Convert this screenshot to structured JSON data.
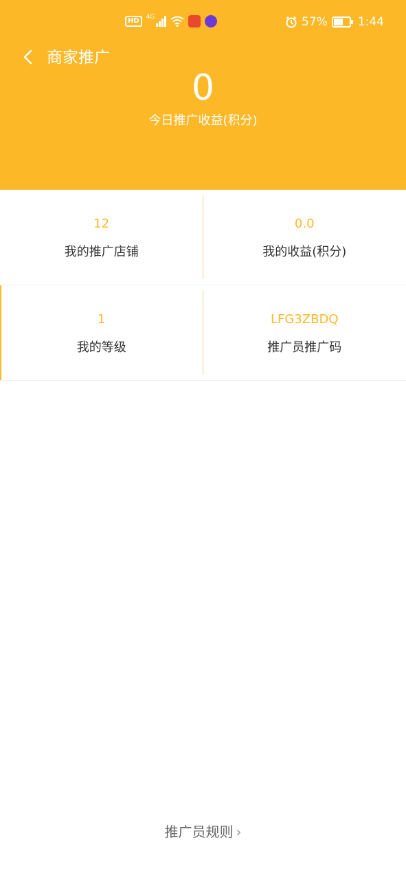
{
  "status_bar": {
    "hd": "HD",
    "network": "4G",
    "battery_percent": "57%",
    "time": "1:44",
    "battery_level": 0.57
  },
  "nav": {
    "title": "商家推广"
  },
  "summary": {
    "today_value": "0",
    "today_label": "今日推广收益(积分)"
  },
  "stats": [
    {
      "value": "12",
      "label": "我的推广店铺"
    },
    {
      "value": "0.0",
      "label": "我的收益(积分)"
    },
    {
      "value": "1",
      "label": "我的等级"
    },
    {
      "value": "LFG3ZBDQ",
      "label": "推广员推广码"
    }
  ],
  "footer": {
    "rules_label": "推广员规则",
    "chevron": "›"
  },
  "colors": {
    "accent": "#FDB827",
    "text_dark": "#333333",
    "text_muted": "#666666"
  },
  "icons": {
    "back": "chevron-left-icon",
    "alarm": "alarm-icon",
    "wifi": "wifi-icon",
    "signal": "signal-icon",
    "battery": "battery-icon",
    "rules_chevron": "chevron-right-icon"
  }
}
